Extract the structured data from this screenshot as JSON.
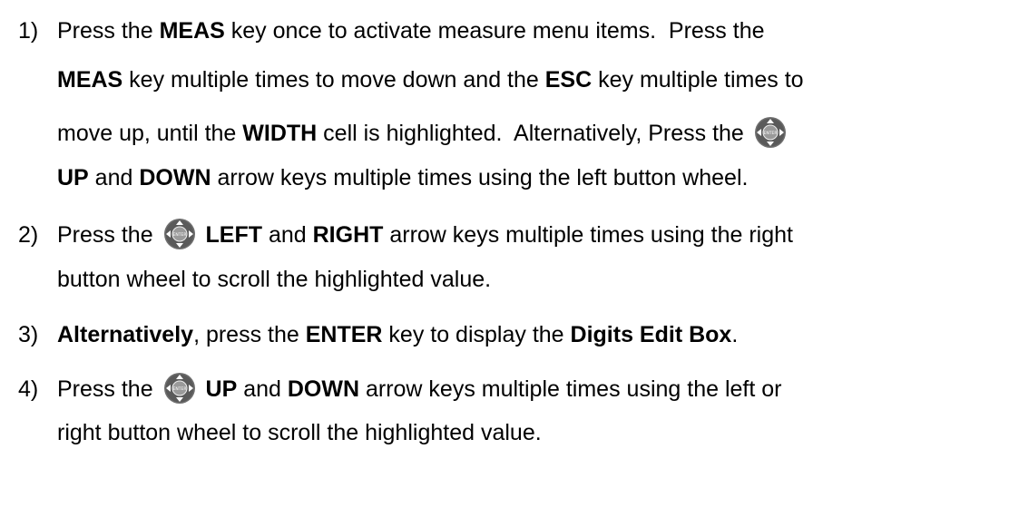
{
  "steps": [
    {
      "number": "1)",
      "lines": [
        [
          {
            "t": "Press the "
          },
          {
            "t": "MEAS",
            "b": true
          },
          {
            "t": " key once to activate measure menu items.  Press the"
          }
        ],
        [
          {
            "t": "MEAS",
            "b": true
          },
          {
            "t": " key multiple times to move down and the "
          },
          {
            "t": "ESC",
            "b": true
          },
          {
            "t": " key multiple times to"
          }
        ],
        [
          {
            "t": "move up, until the "
          },
          {
            "t": "WIDTH",
            "b": true
          },
          {
            "t": " cell is highlighted.  Alternatively, Press the "
          },
          {
            "icon": "enter-wheel-icon"
          }
        ],
        [
          {
            "t": "UP",
            "b": true
          },
          {
            "t": " and "
          },
          {
            "t": "DOWN",
            "b": true
          },
          {
            "t": " arrow keys multiple times using the left button wheel."
          }
        ]
      ]
    },
    {
      "number": "2)",
      "lines": [
        [
          {
            "t": "Press the "
          },
          {
            "icon": "enter-wheel-icon"
          },
          {
            "t": " "
          },
          {
            "t": "LEFT",
            "b": true
          },
          {
            "t": " and "
          },
          {
            "t": "RIGHT",
            "b": true
          },
          {
            "t": " arrow keys multiple times using the right"
          }
        ],
        [
          {
            "t": "button wheel to scroll the highlighted value."
          }
        ]
      ]
    },
    {
      "number": "3)",
      "lines": [
        [
          {
            "t": "Alternatively",
            "b": true
          },
          {
            "t": ", press the "
          },
          {
            "t": "ENTER",
            "b": true
          },
          {
            "t": " key to display the "
          },
          {
            "t": "Digits Edit Box",
            "b": true
          },
          {
            "t": "."
          }
        ]
      ]
    },
    {
      "number": "4)",
      "lines": [
        [
          {
            "t": "Press the "
          },
          {
            "icon": "enter-wheel-icon"
          },
          {
            "t": " "
          },
          {
            "t": "UP",
            "b": true
          },
          {
            "t": " and "
          },
          {
            "t": "DOWN",
            "b": true
          },
          {
            "t": " arrow keys multiple times using the left or"
          }
        ],
        [
          {
            "t": "right button wheel to scroll the highlighted value."
          }
        ]
      ]
    }
  ],
  "icon_label": "ENTER",
  "colors": {
    "text": "#000000",
    "wheel_outer": "#6f6f6f",
    "wheel_inner": "#9a9a9a"
  }
}
